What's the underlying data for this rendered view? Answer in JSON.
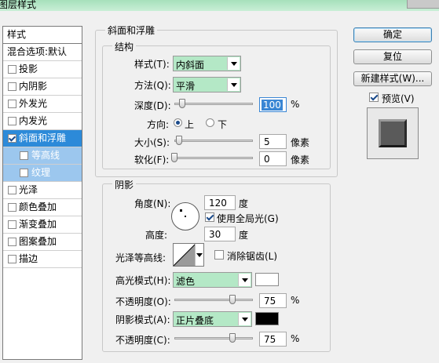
{
  "window": {
    "title": "图层样式"
  },
  "left_panel": {
    "header": "样式",
    "blend": "混合选项:默认",
    "items": [
      {
        "label": "投影",
        "checked": false
      },
      {
        "label": "内阴影",
        "checked": false
      },
      {
        "label": "外发光",
        "checked": false
      },
      {
        "label": "内发光",
        "checked": false
      },
      {
        "label": "斜面和浮雕",
        "checked": true,
        "selected": true
      },
      {
        "label": "等高线",
        "checked": false,
        "sub": true
      },
      {
        "label": "纹理",
        "checked": false,
        "sub": true
      },
      {
        "label": "光泽",
        "checked": false
      },
      {
        "label": "颜色叠加",
        "checked": false
      },
      {
        "label": "渐变叠加",
        "checked": false
      },
      {
        "label": "图案叠加",
        "checked": false
      },
      {
        "label": "描边",
        "checked": false
      }
    ]
  },
  "bevel": {
    "section_title": "斜面和浮雕",
    "structure_title": "结构",
    "style_label": "样式(T):",
    "style_value": "内斜面",
    "technique_label": "方法(Q):",
    "technique_value": "平滑",
    "depth_label": "深度(D):",
    "depth_value": "100",
    "percent": "%",
    "direction_label": "方向:",
    "direction_up": "上",
    "direction_down": "下",
    "size_label": "大小(S):",
    "size_value": "5",
    "soften_label": "软化(F):",
    "soften_value": "0",
    "pixels": "像素"
  },
  "shading": {
    "title": "阴影",
    "angle_label": "角度(N):",
    "angle_value": "120",
    "degree": "度",
    "global_light": "使用全局光(G)",
    "altitude_label": "高度:",
    "altitude_value": "30",
    "gloss_label": "光泽等高线:",
    "antialias_label": "消除锯齿(L)",
    "highlight_label": "高光模式(H):",
    "highlight_value": "滤色",
    "highlight_color": "#ffffff",
    "opacity_label": "不透明度(O):",
    "opacity_value": "75",
    "shadow_label": "阴影模式(A):",
    "shadow_value": "正片叠底",
    "shadow_color": "#000000",
    "opacity2_label": "不透明度(C):",
    "opacity2_value": "75"
  },
  "buttons": {
    "ok": "确定",
    "reset": "复位",
    "new_style": "新建样式(W)...",
    "preview": "预览(V)"
  },
  "colors": {
    "select_bg": "#b4e8c6",
    "selected_item": "#2c8ad9",
    "titlebar": "#a6e0bb"
  }
}
